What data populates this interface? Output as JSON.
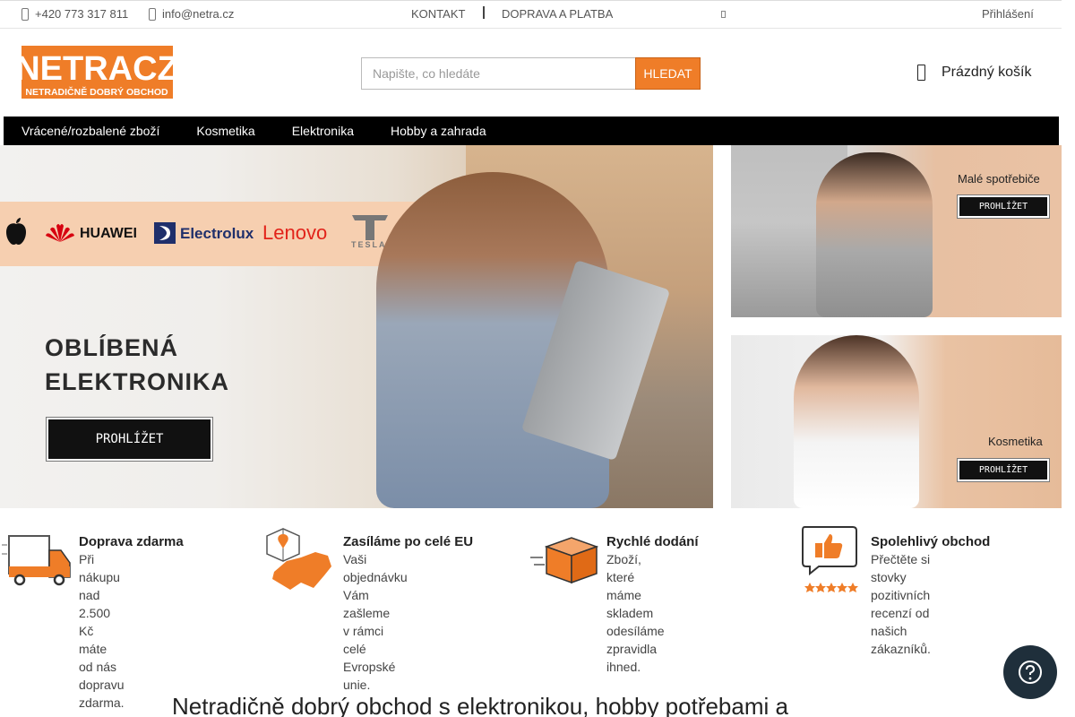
{
  "topbar": {
    "phone": "+420 773 317 811",
    "email": "info@netra.cz",
    "links": [
      "KONTAKT",
      "DOPRAVA A PLATBA"
    ],
    "login": "Přihlášení"
  },
  "header": {
    "logo_text": "NETRACZ",
    "logo_tagline": "NETRADIČNĚ DOBRÝ OBCHOD",
    "search_placeholder": "Napište, co hledáte",
    "search_button": "HLEDAT",
    "cart_label": "Prázdný košík"
  },
  "nav": {
    "items": [
      "Vrácené/rozbalené zboží",
      "Kosmetika",
      "Elektronika",
      "Hobby a zahrada"
    ]
  },
  "hero": {
    "brands": [
      "HUAWEI",
      "Electrolux",
      "Lenovo",
      "TESLA"
    ],
    "headline_line1": "OBLÍBENÁ",
    "headline_line2": "ELEKTRONIKA",
    "button": "PROHLÍŽET"
  },
  "side_banners": [
    {
      "title": "Malé spotřebiče",
      "button": "PROHLÍŽET"
    },
    {
      "title": "Kosmetika",
      "button": "PROHLÍŽET"
    }
  ],
  "features": [
    {
      "icon": "delivery-truck-icon",
      "title": "Doprava zdarma",
      "line1": "Při nákupu nad 2.500 Kč máte",
      "line2": "od nás dopravu zdarma."
    },
    {
      "icon": "europe-map-icon",
      "title": "Zasíláme po celé EU",
      "line1": "Vaši objednávku Vám zašleme",
      "line2": "v rámci celé Evropské unie."
    },
    {
      "icon": "fast-box-icon",
      "title": "Rychlé dodání",
      "line1": "Zboží, které máme skladem",
      "line2": "odesíláme zpravidla ihned."
    },
    {
      "icon": "thumbs-up-rating-icon",
      "title": "Spolehlivý obchod",
      "line1": "Přečtěte si stovky pozitivních",
      "line2": "recenzí od našich zákazníků."
    }
  ],
  "bottom_heading": "Netradičně dobrý obchod s elektronikou, hobby potřebami a",
  "colors": {
    "accent": "#ef7d28",
    "nav_bg": "#000000",
    "help_button": "#1f2f3b"
  }
}
